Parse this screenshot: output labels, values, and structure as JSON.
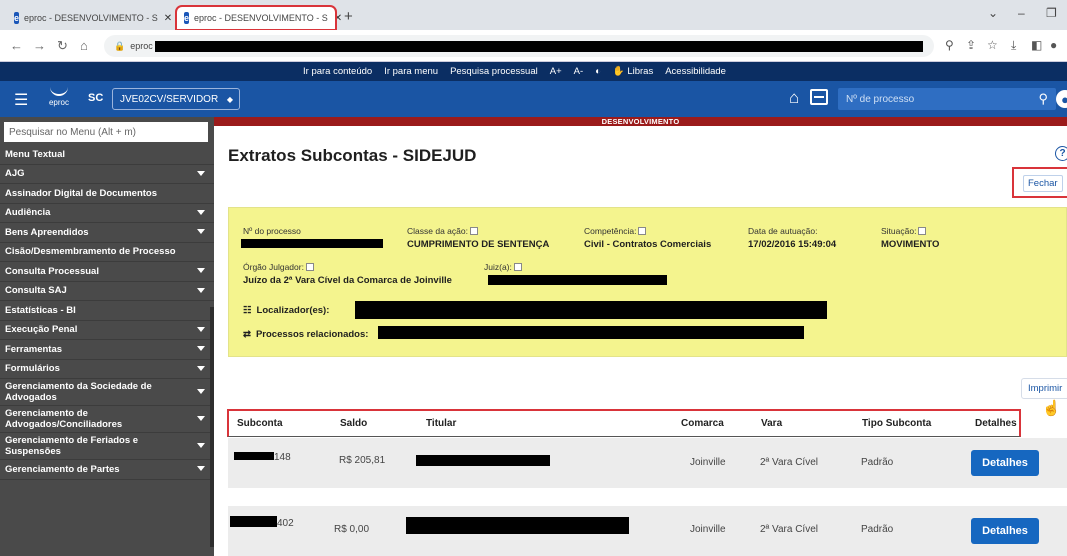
{
  "browser": {
    "tabs": [
      {
        "label": "eproc - DESENVOLVIMENTO - S",
        "favicon": "e"
      },
      {
        "label": "eproc - DESENVOLVIMENTO - S",
        "favicon": "e"
      }
    ],
    "address": "eproc"
  },
  "a11y_bar": [
    "Ir para conteúdo",
    "Ir para menu",
    "Pesquisa processual",
    "A+",
    "A-",
    "◐",
    "✋ Libras",
    "Acessibilidade"
  ],
  "header": {
    "logo_text": "eproc",
    "state": "SC",
    "unit": "JVE02CV/SERVIDOR",
    "search_placeholder": "Nº de processo"
  },
  "sidebar": {
    "search_placeholder": "Pesquisar no Menu (Alt + m)",
    "items": [
      {
        "label": "Menu Textual",
        "arrow": false,
        "tall": false
      },
      {
        "label": "AJG",
        "arrow": true,
        "tall": false
      },
      {
        "label": "Assinador Digital de Documentos",
        "arrow": false,
        "tall": false
      },
      {
        "label": "Audiência",
        "arrow": true,
        "tall": false
      },
      {
        "label": "Bens Apreendidos",
        "arrow": true,
        "tall": false
      },
      {
        "label": "Cisão/Desmembramento de Processo",
        "arrow": false,
        "tall": false
      },
      {
        "label": "Consulta Processual",
        "arrow": true,
        "tall": false
      },
      {
        "label": "Consulta SAJ",
        "arrow": true,
        "tall": false
      },
      {
        "label": "Estatísticas - BI",
        "arrow": false,
        "tall": false
      },
      {
        "label": "Execução Penal",
        "arrow": true,
        "tall": false
      },
      {
        "label": "Ferramentas",
        "arrow": true,
        "tall": false
      },
      {
        "label": "Formulários",
        "arrow": true,
        "tall": false
      },
      {
        "label": "Gerenciamento da Sociedade de Advogados",
        "arrow": true,
        "tall": true
      },
      {
        "label": "Gerenciamento de Advogados/Conciliadores",
        "arrow": true,
        "tall": true
      },
      {
        "label": "Gerenciamento de Feriados e Suspensões",
        "arrow": true,
        "tall": true
      },
      {
        "label": "Gerenciamento de Partes",
        "arrow": true,
        "tall": false
      }
    ]
  },
  "content": {
    "env_banner": "DESENVOLVIMENTO",
    "title": "Extratos Subcontas - SIDEJUD",
    "close_label": "Fechar",
    "print_label": "Imprimir",
    "process": {
      "numero_label": "Nº do processo",
      "classe_label": "Classe da ação:",
      "classe_value": "CUMPRIMENTO DE SENTENÇA",
      "competencia_label": "Competência:",
      "competencia_value": "Civil - Contratos Comerciais",
      "data_label": "Data de autuação:",
      "data_value": "17/02/2016 15:49:04",
      "situacao_label": "Situação:",
      "situacao_value": "MOVIMENTO",
      "orgao_label": "Órgão Julgador:",
      "orgao_value": "Juízo da 2ª Vara Cível da Comarca de Joinville",
      "juiz_label": "Juiz(a):",
      "localizador_label": "Localizador(es):",
      "relacionados_label": "Processos relacionados:"
    },
    "table": {
      "headers": [
        "Subconta",
        "Saldo",
        "Titular",
        "Comarca",
        "Vara",
        "Tipo Subconta",
        "Detalhes"
      ],
      "rows": [
        {
          "subconta": "148",
          "saldo": "R$ 205,81",
          "comarca": "Joinville",
          "vara": "2ª Vara Cível",
          "tipo": "Padrão",
          "detalhes": "Detalhes"
        },
        {
          "subconta": "402",
          "saldo": "R$ 0,00",
          "comarca": "Joinville",
          "vara": "2ª Vara Cível",
          "tipo": "Padrão",
          "detalhes": "Detalhes"
        }
      ]
    }
  }
}
